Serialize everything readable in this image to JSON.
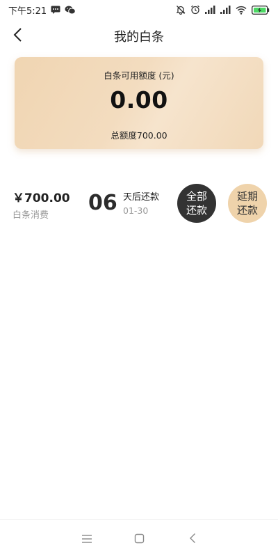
{
  "status_bar": {
    "time": "下午5:21"
  },
  "header": {
    "title": "我的白条"
  },
  "card": {
    "label": "白条可用额度 (元)",
    "amount": "0.00",
    "total": "总额度700.00"
  },
  "bill": {
    "amount": "￥700.00",
    "subtitle": "白条消费",
    "due_days": "06",
    "due_label": "天后还款",
    "due_date": "01-30"
  },
  "actions": {
    "pay_all_label": "全部还款",
    "defer_label": "延期还款"
  },
  "colors": {
    "card_gold": "#f0d5b2",
    "pay_all_bg": "#333333",
    "defer_bg": "#efd3ab"
  }
}
